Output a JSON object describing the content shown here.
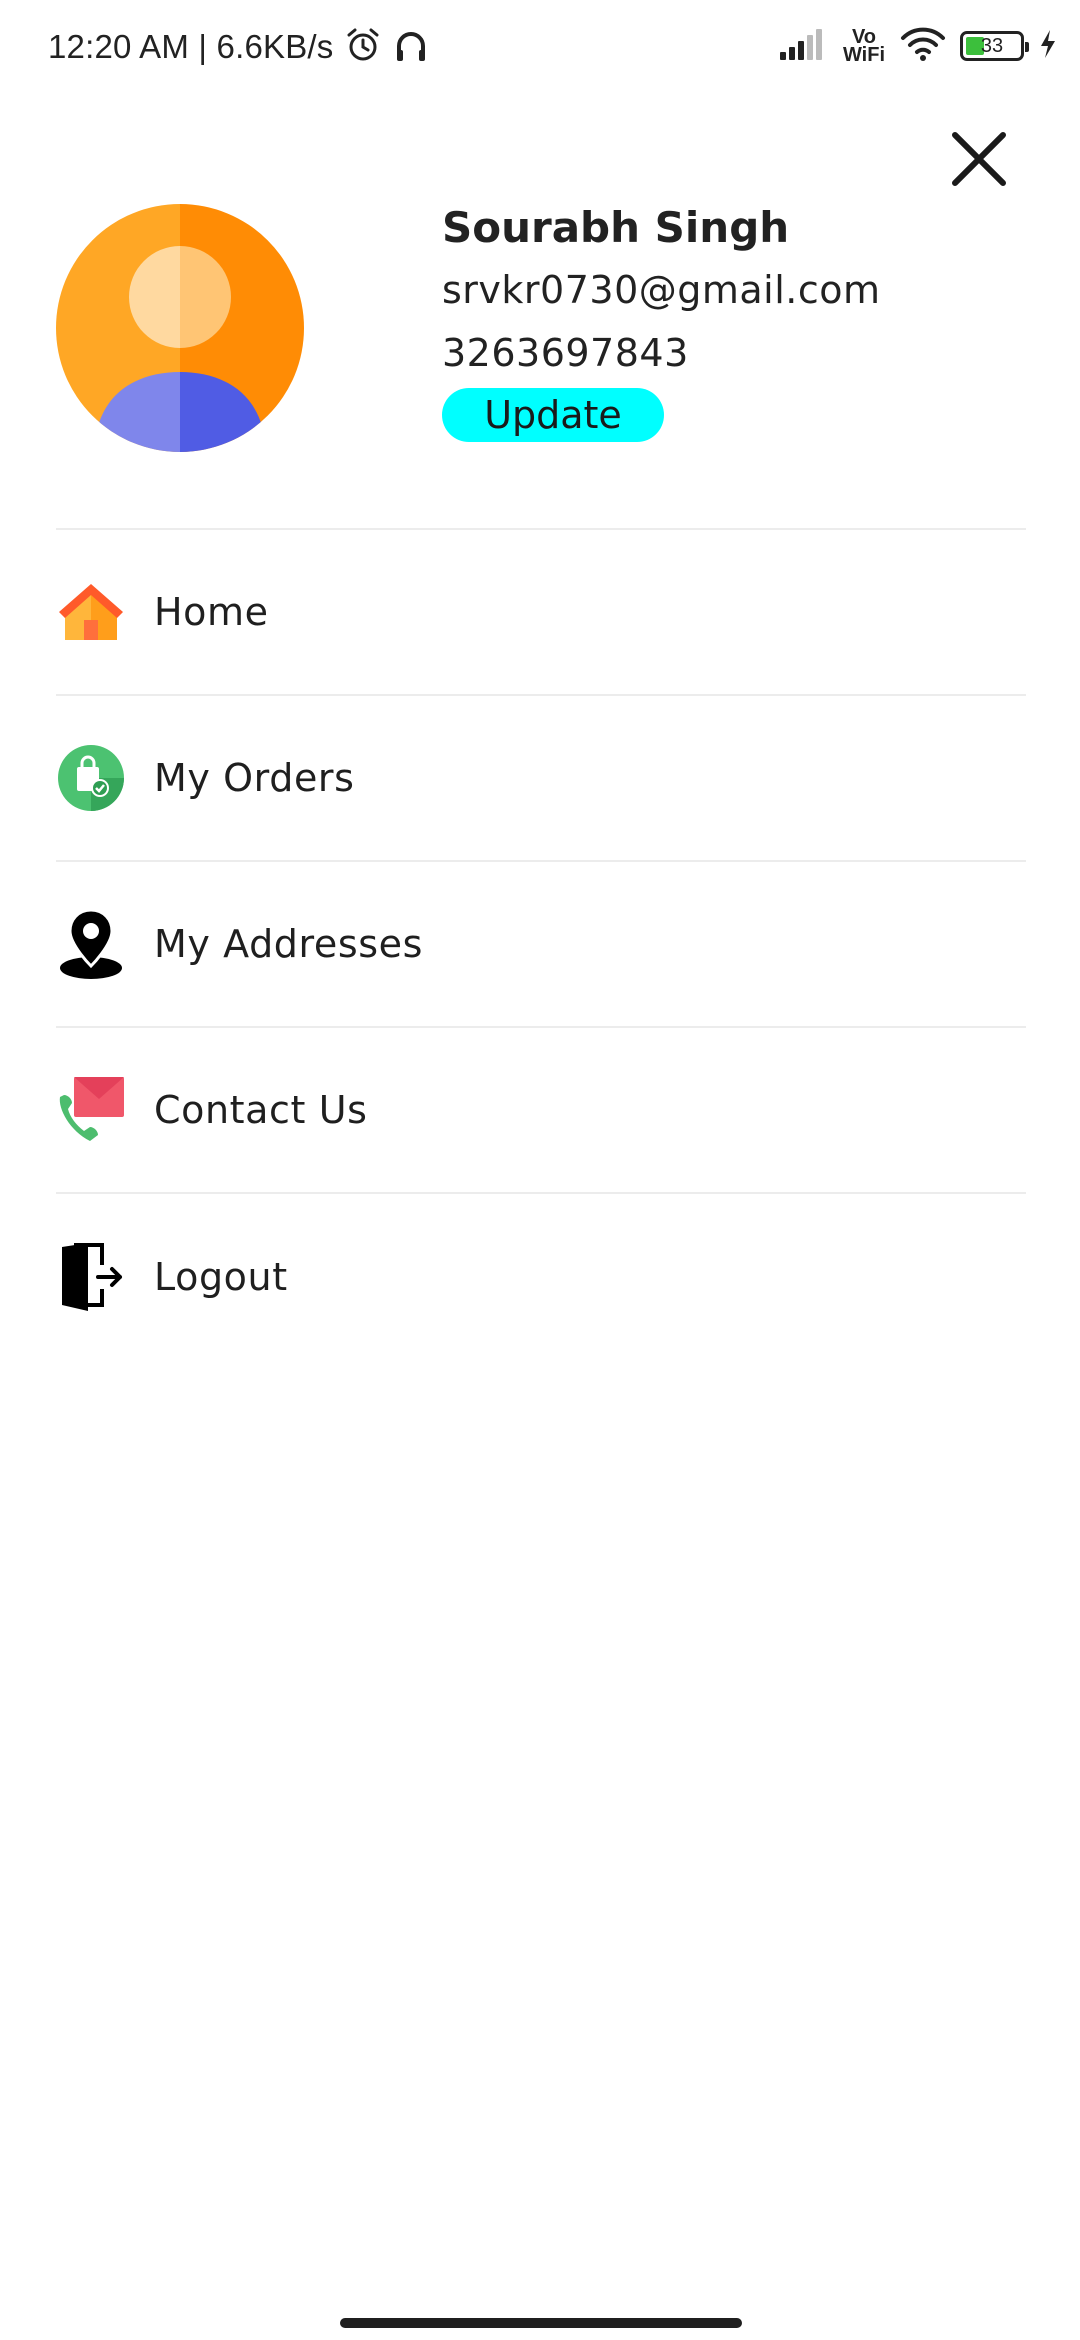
{
  "status_bar": {
    "time_speed": "12:20 AM | 6.6KB/s",
    "vowifi_top": "Vo",
    "vowifi_bottom": "WiFi",
    "battery_level": "33",
    "icons": [
      "alarm-icon",
      "headphones-icon",
      "signal-icon",
      "wifi-icon",
      "battery-icon",
      "charging-icon"
    ]
  },
  "close": {
    "icon": "close-icon"
  },
  "profile": {
    "name": "Sourabh Singh",
    "email": "srvkr0730@gmail.com",
    "phone": "3263697843",
    "update_label": "Update",
    "update_color": "#00ffff"
  },
  "menu": {
    "items": [
      {
        "label": "Home",
        "icon": "home-icon"
      },
      {
        "label": "My Orders",
        "icon": "shopping-bag-icon"
      },
      {
        "label": "My Addresses",
        "icon": "location-pin-icon"
      },
      {
        "label": "Contact Us",
        "icon": "contact-mail-phone-icon"
      },
      {
        "label": "Logout",
        "icon": "logout-door-icon"
      }
    ]
  }
}
